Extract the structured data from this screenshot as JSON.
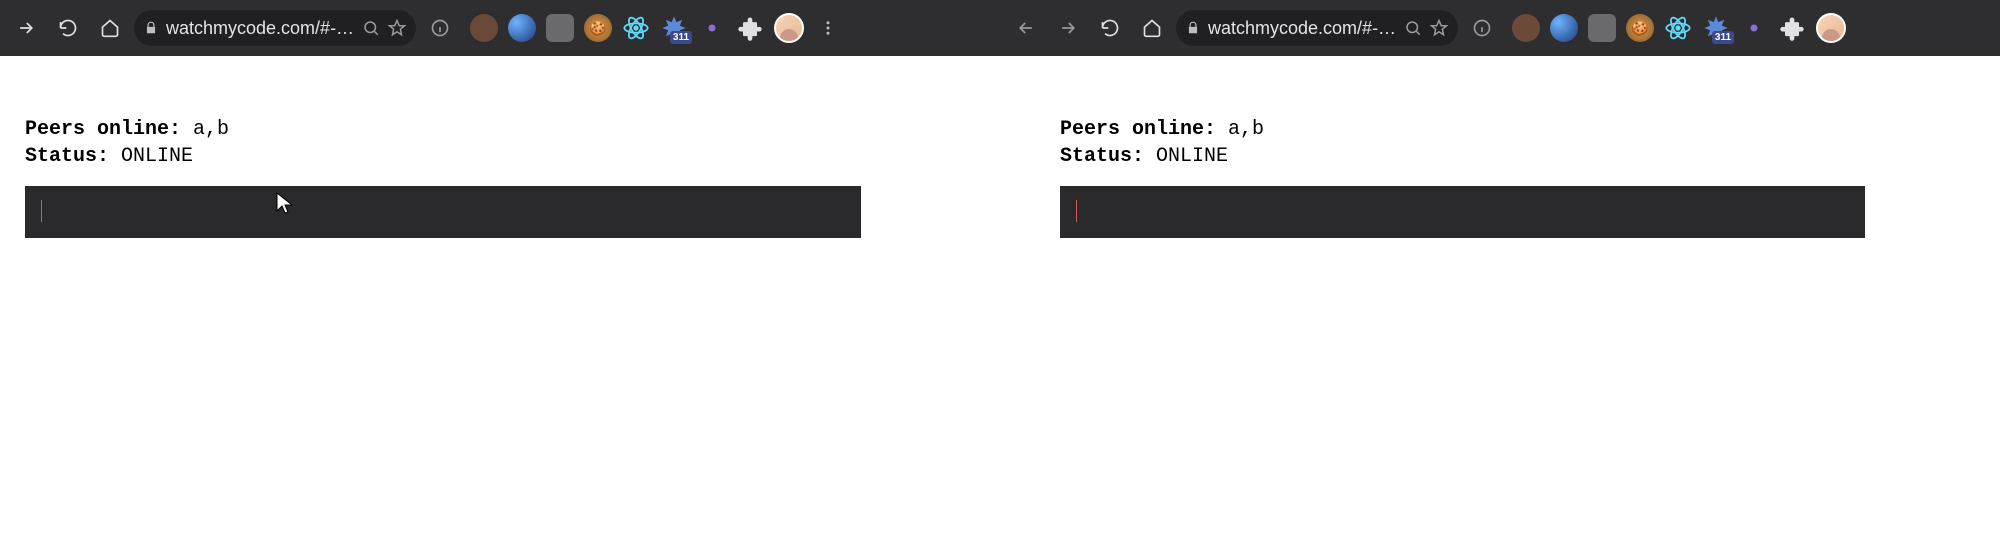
{
  "left": {
    "toolbar": {
      "url": "watchmycode.com/#-…",
      "ext_badge": "311"
    },
    "page": {
      "peers_label": "Peers online: ",
      "peers_value": "a,b",
      "status_label": "Status: ",
      "status_value": "ONLINE"
    }
  },
  "right": {
    "toolbar": {
      "url": "watchmycode.com/#-…",
      "ext_badge": "311"
    },
    "page": {
      "peers_label": "Peers online: ",
      "peers_value": "a,b",
      "status_label": "Status: ",
      "status_value": "ONLINE"
    }
  }
}
